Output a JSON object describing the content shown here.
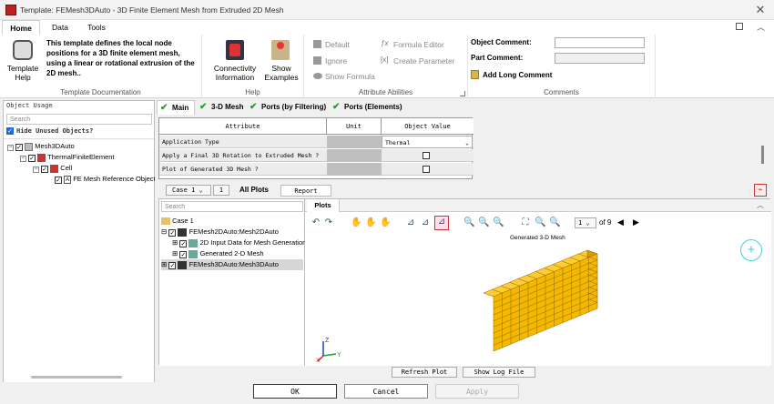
{
  "window": {
    "title": "Template: FEMesh3DAuto - 3D Finite Element Mesh from Extruded 2D Mesh"
  },
  "ribbon": {
    "tabs": [
      "Home",
      "Data",
      "Tools"
    ],
    "description": [
      "This template defines the local node",
      "positions for a 3D finite element mesh,",
      "using a linear or rotational extrusion of the",
      "2D mesh.."
    ],
    "template_help": [
      "Template",
      "Help"
    ],
    "group_template_doc": "Template Documentation",
    "connectivity": [
      "Connectivity",
      "Information"
    ],
    "show_examples": [
      "Show",
      "Examples"
    ],
    "group_help": "Help",
    "default": "Default",
    "ignore": "Ignore",
    "show_formula": "Show Formula",
    "formula_editor": "Formula Editor",
    "create_parameter": "Create Parameter",
    "group_attr": "Attribute Abilities",
    "object_comment": "Object Comment:",
    "part_comment": "Part Comment:",
    "add_long_comment": "Add Long Comment",
    "group_comments": "Comments"
  },
  "left": {
    "title": "Object Usage",
    "search": "Search",
    "hide_unused": "Hide Unused Objects?",
    "tree": [
      "Mesh3DAuto",
      "ThermalFiniteElement",
      "Cell",
      "FE Mesh Reference Object"
    ]
  },
  "tabs": [
    "Main",
    "3-D Mesh",
    "Ports (by Filtering)",
    "Ports (Elements)"
  ],
  "table": {
    "headers": [
      "Attribute",
      "Unit",
      "Object Value"
    ],
    "rows": [
      {
        "attr": "Application Type",
        "value": "Thermal"
      },
      {
        "attr": "Apply a Final 3D Rotation to Extruded Mesh ?",
        "value": ""
      },
      {
        "attr": "Plot of Generated 3D Mesh ?",
        "value": ""
      }
    ]
  },
  "lower": {
    "case": "Case 1",
    "case_num": "1",
    "all_plots": "All Plots",
    "report_tables": "Report Tables",
    "plots_tab": "Plots",
    "tree_search": "Search",
    "tree": [
      "Case 1",
      "FEMesh2DAuto:Mesh2DAuto",
      "2D Input Data for Mesh Generation",
      "Generated 2-D Mesh",
      "FEMesh3DAuto:Mesh3DAuto"
    ],
    "page": "1",
    "page_of": "of 9",
    "plot_title": "Generated 3-D Mesh",
    "refresh": "Refresh Plot",
    "showlog": "Show Log File"
  },
  "buttons": {
    "ok": "OK",
    "cancel": "Cancel",
    "apply": "Apply"
  },
  "colors": {
    "accent": "#1e6bd6",
    "mesh": "#f5b800"
  }
}
